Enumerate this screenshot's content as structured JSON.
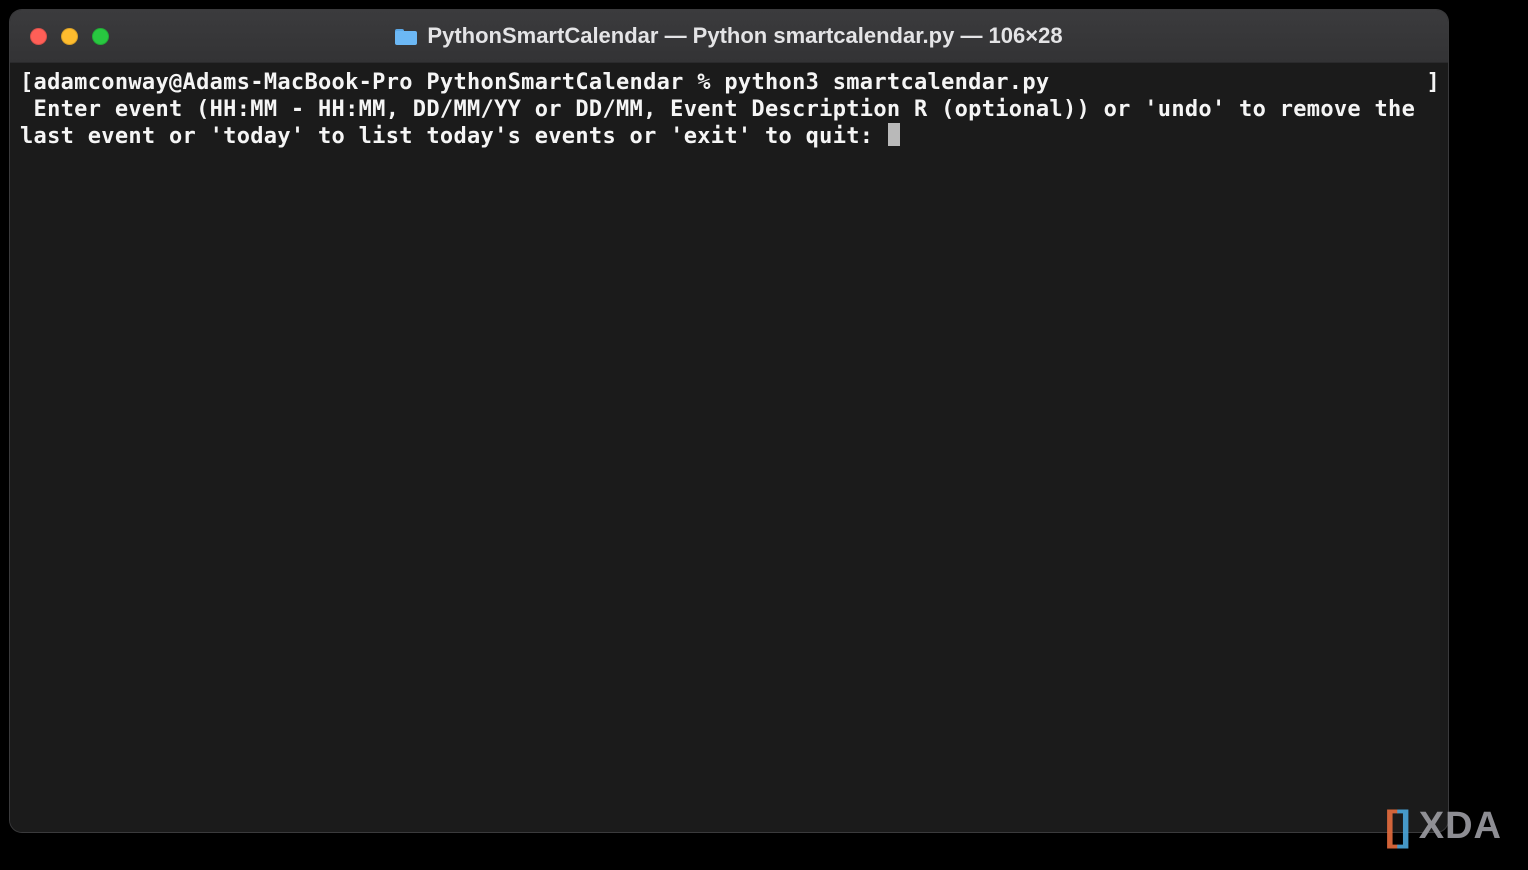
{
  "window": {
    "title": "PythonSmartCalendar — Python smartcalendar.py — 106×28"
  },
  "terminal": {
    "left_bracket": "[",
    "right_bracket": "]",
    "prompt": "adamconway@Adams-MacBook-Pro PythonSmartCalendar % ",
    "command": "python3 smartcalendar.py",
    "output": " Enter event (HH:MM - HH:MM, DD/MM/YY or DD/MM, Event Description R (optional)) or 'undo' to remove the last event or 'today' to list today's events or 'exit' to quit: "
  },
  "watermark": {
    "text": "XDA"
  }
}
